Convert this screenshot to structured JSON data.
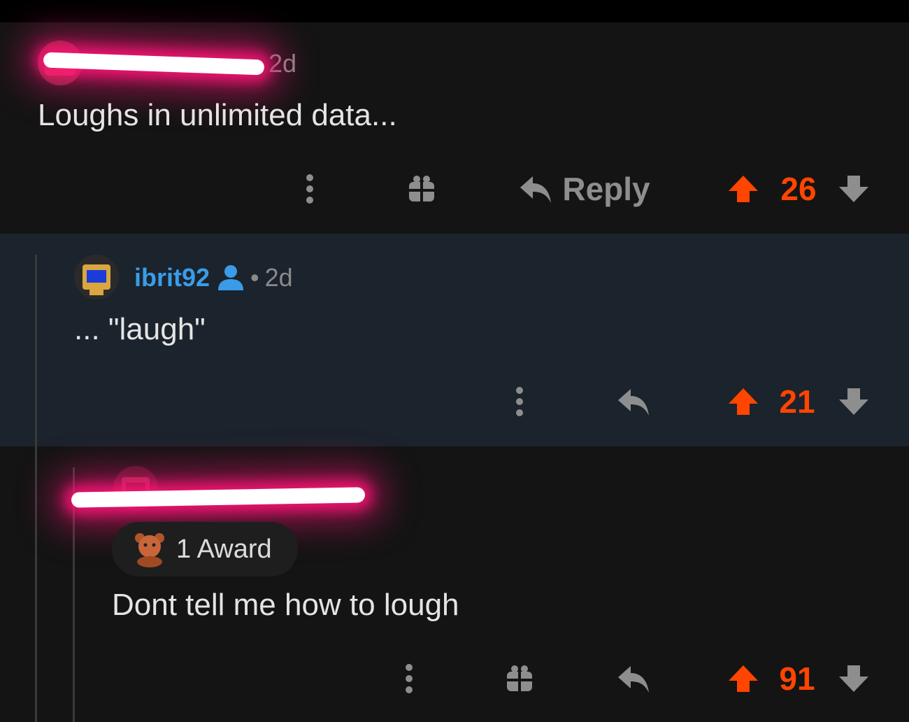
{
  "comments": [
    {
      "time": "2d",
      "body": "Loughs in unlimited data...",
      "reply_label": "Reply",
      "score": "26"
    },
    {
      "username": "ibrit92",
      "separator": "•",
      "time": "2d",
      "body": "... \"laugh\"",
      "score": "21"
    },
    {
      "award_label": "1 Award",
      "body": "Dont tell me how to lough",
      "score": "91"
    }
  ],
  "icons": {
    "more": "more-vertical-icon",
    "award": "gift-icon",
    "reply": "reply-arrow-icon",
    "upvote": "upvote-arrow-icon",
    "downvote": "downvote-arrow-icon",
    "op": "person-icon"
  },
  "colors": {
    "upvote": "#ff4500",
    "username": "#3a9ce8",
    "highlight_bg": "#1b232c",
    "redaction_glow": "#ff1478"
  }
}
